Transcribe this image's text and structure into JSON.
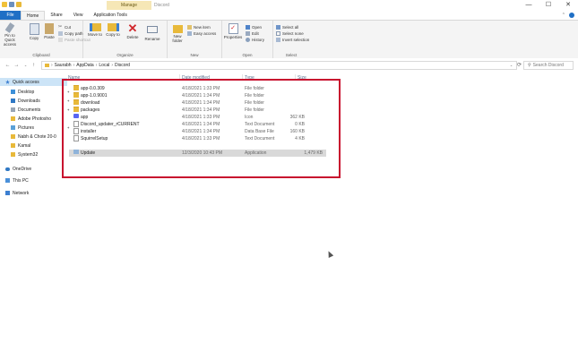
{
  "title_bar": {
    "context_tab": "Manage",
    "window_title": "Discord",
    "controls": [
      "—",
      "☐",
      "✕"
    ]
  },
  "ribbon_tabs": [
    "File",
    "Home",
    "Share",
    "View",
    "Application Tools"
  ],
  "ribbon": {
    "clipboard": {
      "pin": "Pin to Quick access",
      "copy": "Copy",
      "paste": "Paste",
      "cut": "Cut",
      "copy_path": "Copy path",
      "paste_shortcut": "Paste shortcut",
      "label": "Clipboard"
    },
    "organize": {
      "move_to": "Move to",
      "copy_to": "Copy to",
      "delete": "Delete",
      "rename": "Rename",
      "label": "Organize"
    },
    "new": {
      "new_folder": "New folder",
      "new_item": "New item",
      "easy_access": "Easy access",
      "label": "New"
    },
    "open": {
      "properties": "Properties",
      "open": "Open",
      "edit": "Edit",
      "history": "History",
      "label": "Open"
    },
    "select": {
      "select_all": "Select all",
      "select_none": "Select none",
      "invert_selection": "Invert selection",
      "label": "Select"
    }
  },
  "address": {
    "path": [
      "Saurabh",
      "AppData",
      "Local",
      "Discord"
    ],
    "search_placeholder": "Search Discord"
  },
  "nav_pane": [
    {
      "label": "Quick access",
      "icon": "star-icon",
      "selected": true,
      "pinned": false
    },
    {
      "label": "Desktop",
      "icon": "desktop-icon",
      "selected": false,
      "pinned": true
    },
    {
      "label": "Downloads",
      "icon": "download-icon",
      "selected": false,
      "pinned": true
    },
    {
      "label": "Documents",
      "icon": "document-icon",
      "selected": false,
      "pinned": true
    },
    {
      "label": "Adobe Photosho",
      "icon": "folder-icon",
      "selected": false,
      "pinned": false
    },
    {
      "label": "Pictures",
      "icon": "pictures-icon",
      "selected": false,
      "pinned": true
    },
    {
      "label": "Nabh & Chote 20-0",
      "icon": "folder-icon",
      "selected": false,
      "pinned": false
    },
    {
      "label": "Kamal",
      "icon": "folder-icon",
      "selected": false,
      "pinned": false
    },
    {
      "label": "System32",
      "icon": "folder-icon",
      "selected": false,
      "pinned": false
    },
    {
      "label": "OneDrive",
      "icon": "cloud-icon",
      "selected": false,
      "pinned": false
    },
    {
      "label": "This PC",
      "icon": "computer-icon",
      "selected": false,
      "pinned": false
    },
    {
      "label": "Network",
      "icon": "network-icon",
      "selected": false,
      "pinned": false
    }
  ],
  "columns": [
    "Name",
    "Date modified",
    "Type",
    "Size"
  ],
  "files": [
    {
      "name": "app-0.0.309",
      "date": "4/18/2021 1:33 PM",
      "type": "File folder",
      "size": "",
      "kind": "folder"
    },
    {
      "name": "app-1.0.9001",
      "date": "4/18/2021 1:34 PM",
      "type": "File folder",
      "size": "",
      "kind": "folder"
    },
    {
      "name": "download",
      "date": "4/18/2021 1:34 PM",
      "type": "File folder",
      "size": "",
      "kind": "folder"
    },
    {
      "name": "packages",
      "date": "4/18/2021 1:34 PM",
      "type": "File folder",
      "size": "",
      "kind": "folder"
    },
    {
      "name": "app",
      "date": "4/18/2021 1:33 PM",
      "type": "Icon",
      "size": "362 KB",
      "kind": "app"
    },
    {
      "name": "Discord_updater_rCURRENT",
      "date": "4/18/2021 1:34 PM",
      "type": "Text Document",
      "size": "0 KB",
      "kind": "doc"
    },
    {
      "name": "installer",
      "date": "4/18/2021 1:34 PM",
      "type": "Data Base File",
      "size": "160 KB",
      "kind": "doc"
    },
    {
      "name": "SquirrelSetup",
      "date": "4/18/2021 1:33 PM",
      "type": "Text Document",
      "size": "4 KB",
      "kind": "doc"
    },
    {
      "name": "Update",
      "date": "12/3/2020 10:43 PM",
      "type": "Application",
      "size": "1,479 KB",
      "kind": "setup",
      "selected": true
    }
  ]
}
